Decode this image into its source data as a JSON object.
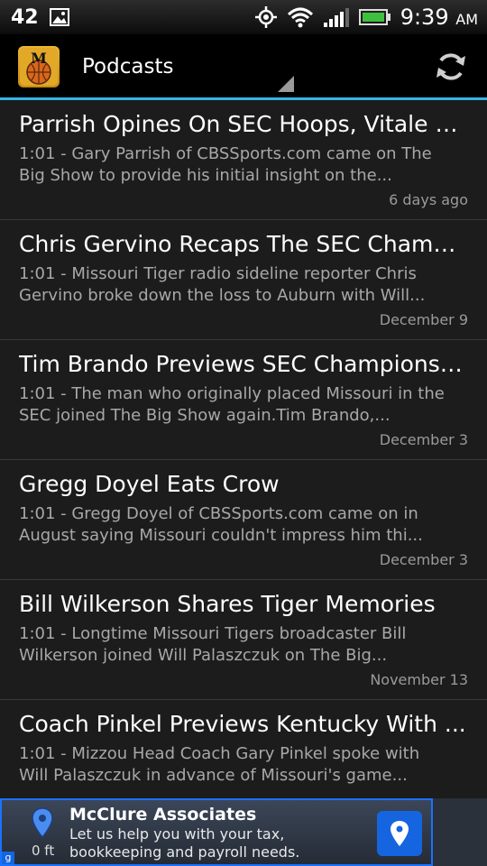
{
  "status_bar": {
    "notification_count": "42",
    "time": "9:39",
    "ampm": "AM",
    "icons": [
      "image-icon",
      "gps-icon",
      "wifi-icon",
      "signal-icon",
      "battery-icon"
    ]
  },
  "action_bar": {
    "title": "Podcasts",
    "app_icon_letter": "M",
    "accent_color": "#33b5e5"
  },
  "podcasts": [
    {
      "title": "Parrish Opines On SEC Hoops, Vitale on...",
      "description": "1:01 - Gary Parrish of CBSSports.com came on The Big Show to provide his initial insight on the...",
      "date": "6 days ago"
    },
    {
      "title": "Chris Gervino Recaps The SEC Champio...",
      "description": "1:01 - Missouri Tiger radio sideline reporter Chris Gervino broke down the loss to Auburn with Will...",
      "date": "December 9"
    },
    {
      "title": "Tim Brando Previews SEC Championship",
      "description": "1:01 - The man who originally placed Missouri in the SEC joined The Big Show again.Tim Brando,...",
      "date": "December 3"
    },
    {
      "title": "Gregg Doyel Eats Crow",
      "description": "1:01 - Gregg Doyel of CBSSports.com came on in August saying Missouri couldn't impress him thi...",
      "date": "December 3"
    },
    {
      "title": "Bill Wilkerson Shares Tiger Memories",
      "description": "1:01 - Longtime Missouri Tigers broadcaster Bill Wilkerson joined Will Palaszczuk on The Big...",
      "date": "November 13"
    },
    {
      "title": "Coach Pinkel Previews Kentucky With ...",
      "description": "1:01 - Mizzou Head Coach Gary Pinkel spoke with Will Palaszczuk in advance of Missouri's game...",
      "date": ""
    }
  ],
  "ad": {
    "title": "McClure Associates",
    "text": "Let us help you with your tax, bookkeeping and payroll needs.",
    "distance": "0 ft",
    "badge": "g"
  }
}
